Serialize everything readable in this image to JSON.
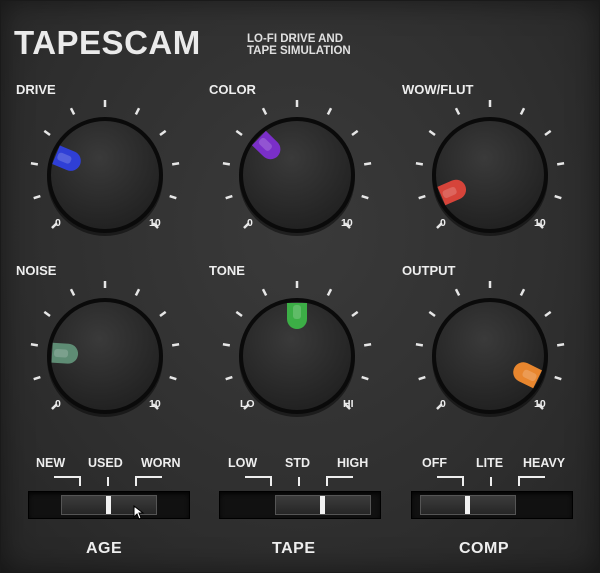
{
  "header": {
    "title": "TAPESCAM",
    "subtitle": "LO-FI DRIVE AND\nTAPE SIMULATION"
  },
  "knobs": [
    {
      "name": "DRIVE",
      "min_label": "0",
      "max_label": "10",
      "value": 0.25,
      "indicator_color": "#2f3fd6"
    },
    {
      "name": "COLOR",
      "min_label": "0",
      "max_label": "10",
      "value": 0.33,
      "indicator_color": "#7a2fc8"
    },
    {
      "name": "WOW/FLUT",
      "min_label": "0",
      "max_label": "10",
      "value": 0.08,
      "indicator_color": "#d6443a"
    },
    {
      "name": "NOISE",
      "min_label": "0",
      "max_label": "10",
      "value": 0.18,
      "indicator_color": "#5e8c74"
    },
    {
      "name": "TONE",
      "min_label": "LO",
      "max_label": "HI",
      "value": 0.5,
      "indicator_color": "#3cae46"
    },
    {
      "name": "OUTPUT",
      "min_label": "0",
      "max_label": "10",
      "value": 0.93,
      "indicator_color": "#e8862e"
    }
  ],
  "switches": [
    {
      "name": "AGE",
      "options": [
        "NEW",
        "USED",
        "WORN"
      ],
      "selected": "USED"
    },
    {
      "name": "TAPE",
      "options": [
        "LOW",
        "STD",
        "HIGH"
      ],
      "selected": "HIGH"
    },
    {
      "name": "COMP",
      "options": [
        "OFF",
        "LITE",
        "HEAVY"
      ],
      "selected": "OFF"
    }
  ],
  "colors": {
    "knob_body": "#2a2a2a",
    "knob_ring": "#0a0a0a",
    "tick": "#e6e6e6",
    "background": "#2f2f2f"
  }
}
